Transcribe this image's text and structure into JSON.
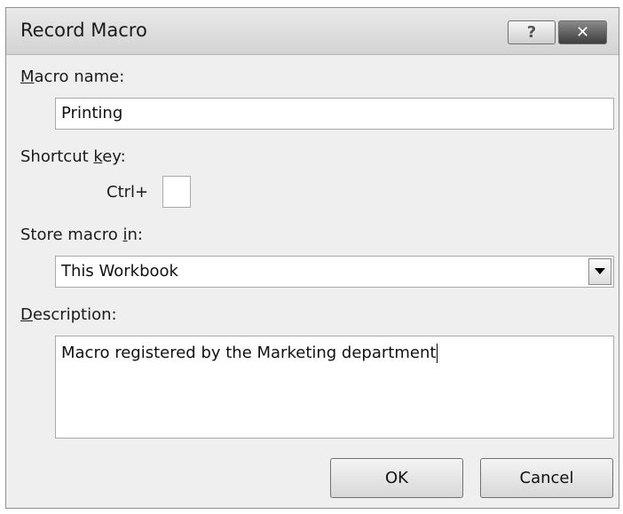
{
  "dialog": {
    "title": "Record Macro",
    "help_label": "?",
    "close_label": "✕"
  },
  "macro_name": {
    "label_mnemonic": "M",
    "label_rest": "acro name:",
    "value": "Printing"
  },
  "shortcut": {
    "label_before": "Shortcut ",
    "label_mnemonic": "k",
    "label_after": "ey:",
    "ctrl_label": "Ctrl+",
    "value": ""
  },
  "store": {
    "label_before": "Store macro ",
    "label_mnemonic": "i",
    "label_after": "n:",
    "selected": "This Workbook"
  },
  "description": {
    "label_mnemonic": "D",
    "label_rest": "escription:",
    "value": "Macro registered by the Marketing department"
  },
  "buttons": {
    "ok": "OK",
    "cancel": "Cancel"
  }
}
